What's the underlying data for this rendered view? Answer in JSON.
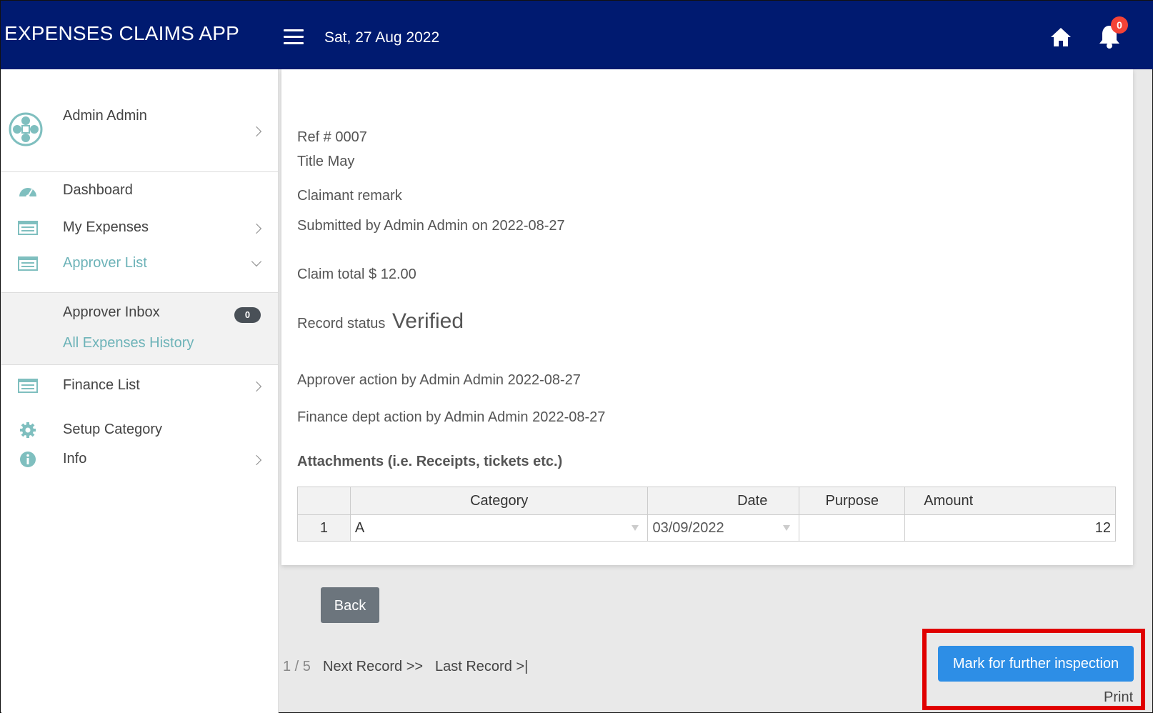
{
  "header": {
    "app_title": "EXPENSES CLAIMS APP",
    "date": "Sat, 27 Aug 2022",
    "notification_count": "0",
    "brand_color": "#001a70"
  },
  "sidebar": {
    "user_name": "Admin Admin",
    "items": [
      {
        "label": "Dashboard",
        "icon": "dashboard-icon"
      },
      {
        "label": "My Expenses",
        "icon": "list-icon"
      },
      {
        "label": "Approver List",
        "icon": "list-icon"
      },
      {
        "label": "Finance List",
        "icon": "list-icon"
      },
      {
        "label": "Setup Category",
        "icon": "gear-icon"
      },
      {
        "label": "Info",
        "icon": "info-icon"
      }
    ],
    "submenu": {
      "inbox_label": "Approver Inbox",
      "inbox_count": "0",
      "history_label": "All Expenses History"
    },
    "accent_color": "#6db3b8"
  },
  "record": {
    "ref": "Ref # 0007",
    "title": "Title May",
    "claimant_remark": "Claimant remark",
    "submitted": "Submitted by Admin Admin on 2022-08-27",
    "claim_total": "Claim total $ 12.00",
    "status_label": "Record status",
    "status_value": "Verified",
    "approver_action": "Approver action by Admin Admin 2022-08-27",
    "finance_action": "Finance dept action by Admin Admin 2022-08-27",
    "attachments_title": "Attachments (i.e. Receipts, tickets etc.)"
  },
  "attachments_table": {
    "headers": [
      "",
      "Category",
      "Date",
      "Purpose",
      "Amount"
    ],
    "rows": [
      {
        "num": "1",
        "category": "A",
        "date": "03/09/2022",
        "purpose": "",
        "amount": "12"
      }
    ]
  },
  "actions": {
    "back_label": "Back",
    "page_count": "1 / 5",
    "next_label": "Next Record >>",
    "last_label": "Last Record >|",
    "mark_label": "Mark for further inspection",
    "print_label": "Print",
    "mark_color": "#2d8ee6"
  }
}
